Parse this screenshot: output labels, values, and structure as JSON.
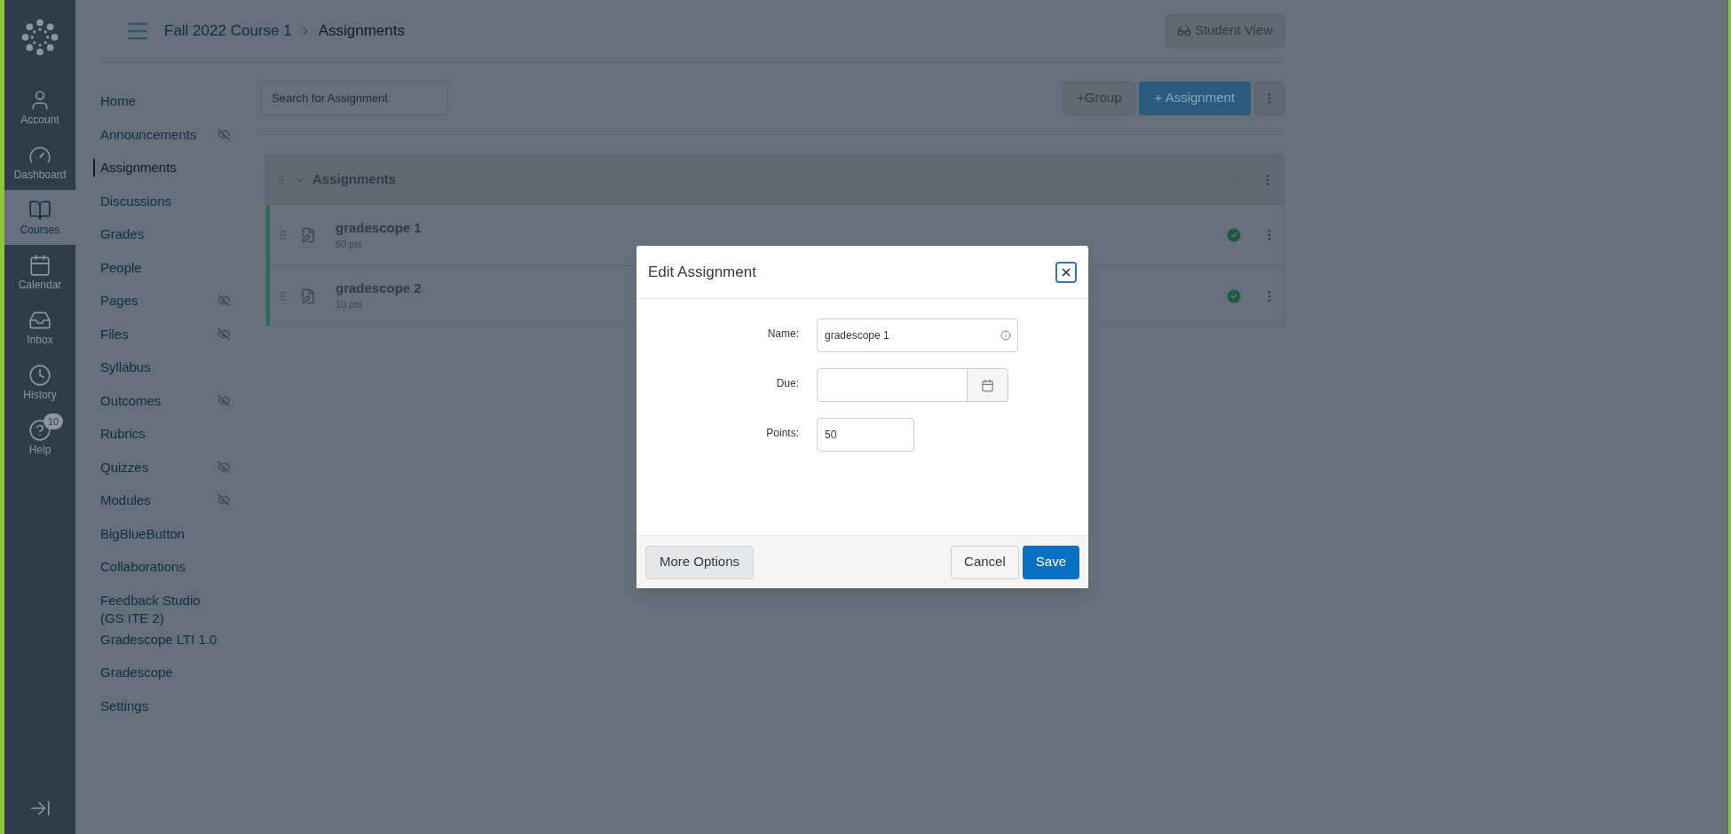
{
  "global_nav": [
    {
      "label": "Account",
      "selected": false
    },
    {
      "label": "Dashboard",
      "selected": false
    },
    {
      "label": "Courses",
      "selected": true
    },
    {
      "label": "Calendar",
      "selected": false
    },
    {
      "label": "Inbox",
      "selected": false
    },
    {
      "label": "History",
      "selected": false
    },
    {
      "label": "Help",
      "selected": false,
      "badge": "10"
    }
  ],
  "breadcrumb": [
    "Fall 2022 Course 1",
    "Assignments"
  ],
  "student_view_button": "Student View",
  "course_nav": [
    {
      "label": "Home",
      "hidden": false,
      "selected": false
    },
    {
      "label": "Announcements",
      "hidden": true,
      "selected": false
    },
    {
      "label": "Assignments",
      "hidden": false,
      "selected": true
    },
    {
      "label": "Discussions",
      "hidden": false,
      "selected": false
    },
    {
      "label": "Grades",
      "hidden": false,
      "selected": false
    },
    {
      "label": "People",
      "hidden": false,
      "selected": false
    },
    {
      "label": "Pages",
      "hidden": true,
      "selected": false
    },
    {
      "label": "Files",
      "hidden": true,
      "selected": false
    },
    {
      "label": "Syllabus",
      "hidden": false,
      "selected": false
    },
    {
      "label": "Outcomes",
      "hidden": true,
      "selected": false
    },
    {
      "label": "Rubrics",
      "hidden": false,
      "selected": false
    },
    {
      "label": "Quizzes",
      "hidden": true,
      "selected": false
    },
    {
      "label": "Modules",
      "hidden": true,
      "selected": false
    },
    {
      "label": "BigBlueButton",
      "hidden": false,
      "selected": false
    },
    {
      "label": "Collaborations",
      "hidden": false,
      "selected": false
    },
    {
      "label": "Feedback Studio (GS ITE 2)",
      "hidden": false,
      "selected": false
    },
    {
      "label": "Gradescope LTI 1.0",
      "hidden": false,
      "selected": false
    },
    {
      "label": "Gradescope",
      "hidden": false,
      "selected": false
    },
    {
      "label": "Settings",
      "hidden": false,
      "selected": false
    }
  ],
  "search": {
    "placeholder": "Search for Assignment"
  },
  "toolbar": {
    "group_button": "+Group",
    "assignment_button": "+ Assignment"
  },
  "group": {
    "title": "Assignments",
    "expanded": true,
    "assignments": [
      {
        "name": "gradescope 1",
        "points": "50 pts",
        "published": true
      },
      {
        "name": "gradescope 2",
        "points": "10 pts",
        "published": true
      }
    ]
  },
  "dialog": {
    "title": "Edit Assignment",
    "fields": [
      {
        "kind": "text",
        "label": "Name:",
        "value": "gradescope 1"
      },
      {
        "kind": "date",
        "label": "Due:"
      },
      {
        "kind": "short",
        "label": "Points:",
        "value": "50"
      }
    ],
    "more_button": "More Options",
    "cancel_button": "Cancel",
    "save_button": "Save"
  }
}
